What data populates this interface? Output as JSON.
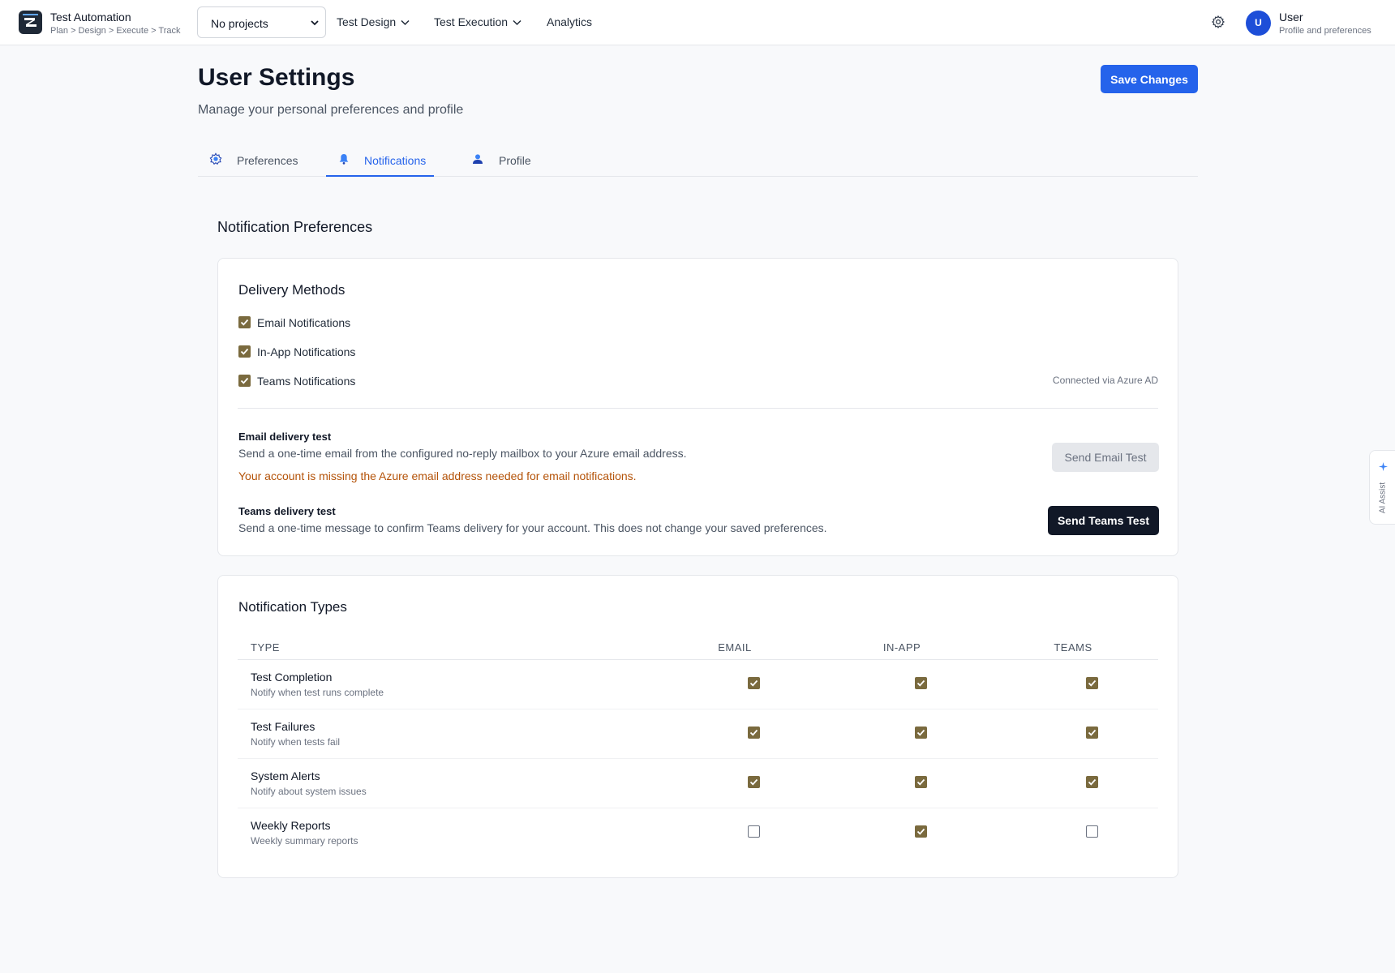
{
  "app": {
    "title": "Test Automation",
    "breadcrumb": "Plan > Design > Execute > Track"
  },
  "project_select": {
    "value": "No projects"
  },
  "nav": {
    "test_design": "Test Design",
    "test_execution": "Test Execution",
    "analytics": "Analytics"
  },
  "user": {
    "initial": "U",
    "name": "User",
    "subtitle": "Profile and preferences"
  },
  "page": {
    "title": "User Settings",
    "subtitle": "Manage your personal preferences and profile",
    "save_label": "Save Changes"
  },
  "tabs": [
    {
      "label": "Preferences",
      "icon": "gear-icon",
      "active": false
    },
    {
      "label": "Notifications",
      "icon": "bell-icon",
      "active": true
    },
    {
      "label": "Profile",
      "icon": "person-icon",
      "active": false
    }
  ],
  "notification_preferences": {
    "section_title": "Notification Preferences",
    "delivery": {
      "title": "Delivery Methods",
      "methods": [
        {
          "label": "Email Notifications",
          "checked": true
        },
        {
          "label": "In-App Notifications",
          "checked": true
        },
        {
          "label": "Teams Notifications",
          "checked": true
        }
      ],
      "teams_status": "Connected via Azure AD",
      "email_test": {
        "title": "Email delivery test",
        "description": "Send a one-time email from the configured no-reply mailbox to your Azure email address.",
        "warning": "Your account is missing the Azure email address needed for email notifications.",
        "button": "Send Email Test"
      },
      "teams_test": {
        "title": "Teams delivery test",
        "description": "Send a one-time message to confirm Teams delivery for your account. This does not change your saved preferences.",
        "button": "Send Teams Test"
      }
    },
    "types": {
      "title": "Notification Types",
      "columns": [
        "TYPE",
        "EMAIL",
        "IN-APP",
        "TEAMS"
      ],
      "rows": [
        {
          "title": "Test Completion",
          "subtitle": "Notify when test runs complete",
          "email": true,
          "inapp": true,
          "teams": true
        },
        {
          "title": "Test Failures",
          "subtitle": "Notify when tests fail",
          "email": true,
          "inapp": true,
          "teams": true
        },
        {
          "title": "System Alerts",
          "subtitle": "Notify about system issues",
          "email": true,
          "inapp": true,
          "teams": true
        },
        {
          "title": "Weekly Reports",
          "subtitle": "Weekly summary reports",
          "email": false,
          "inapp": true,
          "teams": false
        }
      ]
    }
  },
  "assistant": {
    "label": "AI Assist",
    "icon": "sparkle-icon"
  },
  "colors": {
    "accent": "#2563eb",
    "checkbox": "#7a6a3e",
    "warning": "#b45309",
    "dark_button": "#111827"
  }
}
